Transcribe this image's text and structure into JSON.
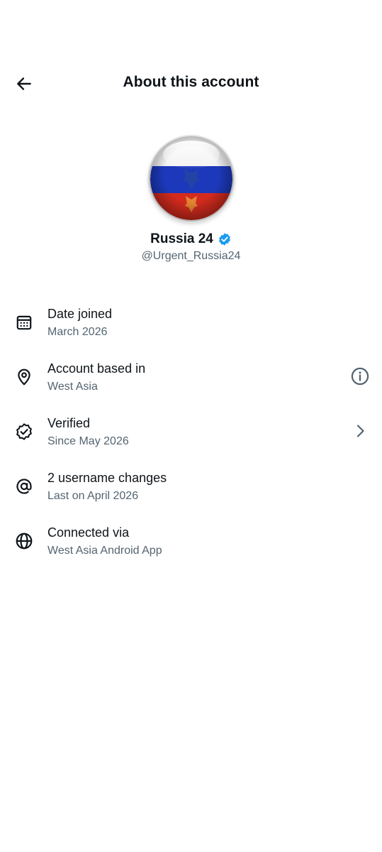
{
  "header": {
    "title": "About this account",
    "back_icon": "arrow-left-icon"
  },
  "profile": {
    "display_name": "Russia 24",
    "handle": "@Urgent_Russia24",
    "verified": true,
    "verified_color": "#1d9bf0",
    "avatar": "russian-flag-coat-of-arms-orb"
  },
  "info": [
    {
      "title": "Date joined",
      "subtitle": "March 2026",
      "icon": "calendar-icon"
    },
    {
      "title": "Account based in",
      "subtitle": "West Asia",
      "icon": "location-pin-icon",
      "action_icon": "info-circle-icon"
    },
    {
      "title": "Verified",
      "subtitle": "Since May 2026",
      "icon": "verified-badge-icon",
      "action_icon": "chevron-right-icon"
    },
    {
      "title": "2 username changes",
      "subtitle": "Last on April 2026",
      "icon": "at-sign-icon"
    },
    {
      "title": "Connected via",
      "subtitle": "West Asia Android App",
      "icon": "globe-icon"
    }
  ],
  "colors": {
    "text_primary": "#0f1419",
    "text_secondary": "#536471",
    "flag_white": "#f4f4f4",
    "flag_blue": "#1c39bb",
    "flag_red": "#d52b1e"
  }
}
